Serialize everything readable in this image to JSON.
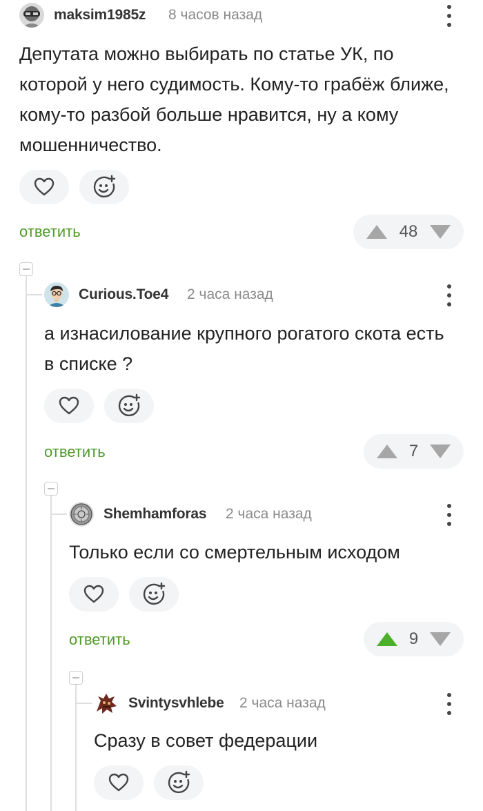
{
  "comments": [
    {
      "username": "maksim1985z",
      "time": "8 часов назад",
      "text": "Депутата можно выбирать по статье УК, по которой у него судимость. Кому-то грабёж ближе, кому-то разбой больше нравится, ну а кому мошенничество.",
      "reply_label": "ответить",
      "rating": "48",
      "upvoted": false
    },
    {
      "username": "Curious.Toe4",
      "time": "2 часа назад",
      "text": "а изнасилование крупного рогатого скота есть в списке ?",
      "reply_label": "ответить",
      "rating": "7",
      "upvoted": false
    },
    {
      "username": "Shemhamforas",
      "time": "2 часа назад",
      "text": "Только если со смертельным исходом",
      "reply_label": "ответить",
      "rating": "9",
      "upvoted": true
    },
    {
      "username": "Svintysvhlebe",
      "time": "2 часа назад",
      "text": "Сразу в совет федерации"
    }
  ],
  "icons": {
    "like": "heart-icon",
    "reaction": "add-emoji-icon",
    "menu": "more-vertical-icon",
    "upvote": "arrow-up-icon",
    "downvote": "arrow-down-icon",
    "collapse": "collapse-minus-icon"
  },
  "colors": {
    "reply_link": "#4e9a26",
    "upvote_active": "#4caf2a",
    "vote_inactive": "#a6a6a6",
    "thread_line": "#dedede"
  }
}
